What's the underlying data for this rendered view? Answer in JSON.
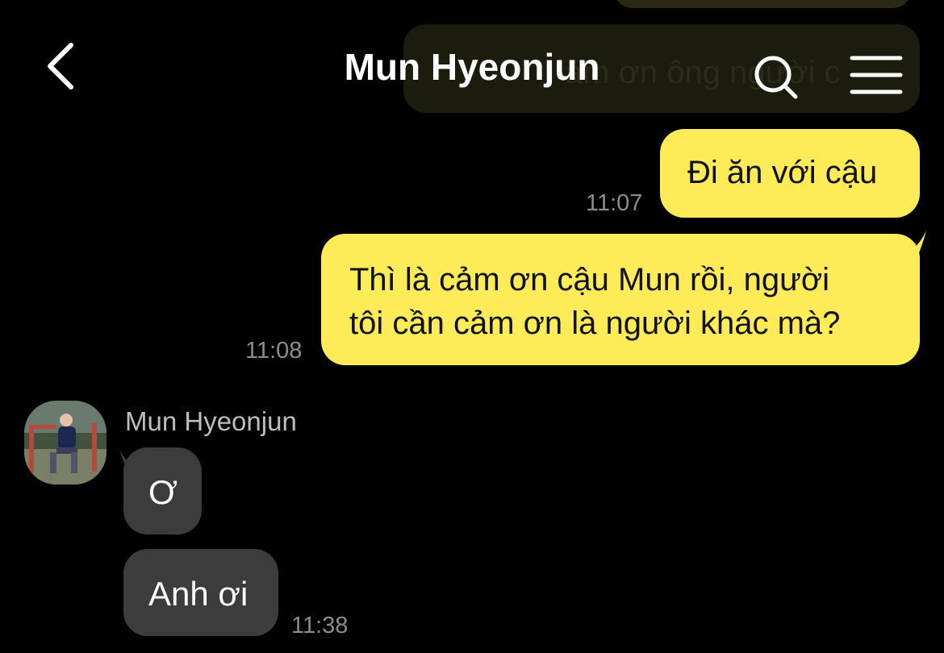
{
  "header": {
    "title": "Mun Hyeonjun",
    "back_icon": "chevron-left-icon",
    "search_icon": "search-icon",
    "menu_icon": "hamburger-menu-icon"
  },
  "colors": {
    "background": "#000000",
    "outgoing_bubble": "#fdeb58",
    "incoming_bubble": "#3c3c3c",
    "timestamp": "#8c8c8c"
  },
  "background_messages": {
    "partial_text": "ảm ơn ông người c"
  },
  "messages": [
    {
      "direction": "out",
      "text": "Đi ăn với cậu",
      "time": "11:07"
    },
    {
      "direction": "out",
      "lines": [
        "Thì là cảm ơn cậu Mun rồi, người",
        "tôi cần cảm ơn là người khác mà?"
      ],
      "time": "11:08"
    },
    {
      "direction": "in",
      "sender": "Mun Hyeonjun",
      "text": "Ơ"
    },
    {
      "direction": "in",
      "text": "Anh ơi",
      "time": "11:38"
    }
  ]
}
